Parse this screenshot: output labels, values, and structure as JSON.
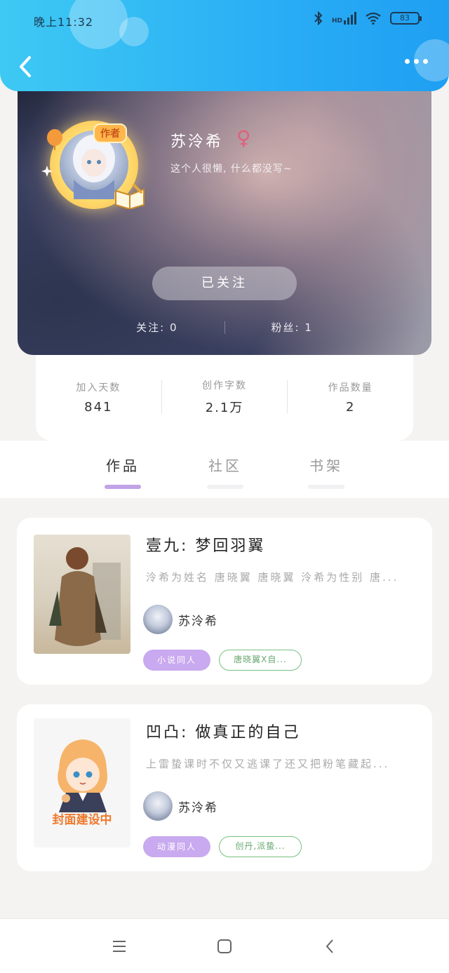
{
  "status_bar": {
    "time": "晚上11:32",
    "network": "HD",
    "battery": "83"
  },
  "profile": {
    "name": "苏泠希",
    "gender_symbol": "♀",
    "bio": "这个人很懒, 什么都没写~",
    "badge": "作者",
    "follow_button": "已关注",
    "following_label": "关注:",
    "following_count": "0",
    "fans_label": "粉丝:",
    "fans_count": "1"
  },
  "stats": [
    {
      "label": "加入天数",
      "value": "841"
    },
    {
      "label": "创作字数",
      "value": "2.1万"
    },
    {
      "label": "作品数量",
      "value": "2"
    }
  ],
  "tabs": [
    {
      "label": "作品",
      "active": true
    },
    {
      "label": "社区",
      "active": false
    },
    {
      "label": "书架",
      "active": false
    }
  ],
  "works": [
    {
      "title": "壹九: 梦回羽翼",
      "desc": "泠希为姓名 唐晓翼 唐晓翼 泠希为性别 唐...",
      "author": "苏泠希",
      "tags": [
        "小说同人",
        "唐晓翼X自..."
      ]
    },
    {
      "title": "凹凸: 做真正的自己",
      "desc": "上雷蛰课时不仅又逃课了还又把粉笔藏起...",
      "author": "苏泠希",
      "tags": [
        "动漫同人",
        "创丹,派蛰..."
      ],
      "cover_text": "封面建设中"
    }
  ],
  "colors": {
    "header_blue": "#2aaef5",
    "tab_active": "#c1a3e6",
    "tag_purple": "#c9a9ef",
    "tag_green": "#79c07f",
    "gender": "#e0607f"
  }
}
